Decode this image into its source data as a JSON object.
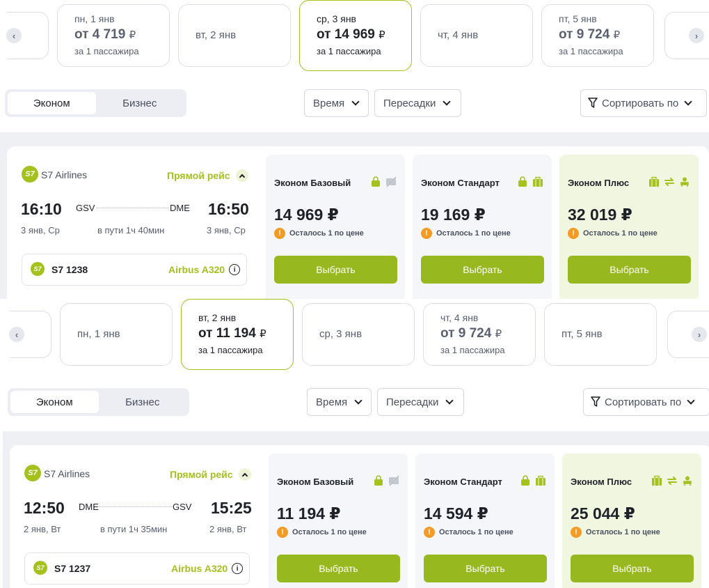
{
  "panels": [
    {
      "dates": [
        {
          "day": "пн, 1 янв",
          "prefix": "от",
          "price": "4 719",
          "currency": "₽",
          "passenger": "за 1 пассажира"
        },
        {
          "day": "вт, 2 янв"
        },
        {
          "day": "ср, 3 янв",
          "prefix": "от",
          "price": "14 969",
          "currency": "₽",
          "passenger": "за 1 пассажира",
          "active": true
        },
        {
          "day": "чт, 4 янв"
        },
        {
          "day": "пт, 5 янв",
          "prefix": "от",
          "price": "9 724",
          "currency": "₽",
          "passenger": "за 1 пассажира"
        }
      ],
      "class_toggle": {
        "economy": "Эконом",
        "business": "Бизнес",
        "selected": "Эконом"
      },
      "filters": {
        "time": "Время",
        "stops": "Пересадки",
        "sort": "Сортировать по"
      },
      "flight": {
        "airline": "S7 Airlines",
        "airline_logo": "S7",
        "direct": "Прямой рейс",
        "dep_time": "16:10",
        "dep_code": "GSV",
        "arr_code": "DME",
        "arr_time": "16:50",
        "dep_date": "3 янв, Ср",
        "duration": "в пути 1ч 40мин",
        "arr_date": "3 янв, Ср",
        "flight_number": "S7 1238",
        "aircraft": "Airbus A320"
      },
      "fares": [
        {
          "name": "Эконом Базовый",
          "price": "14 969 ₽",
          "left": "Осталось 1 по цене",
          "button": "Выбрать"
        },
        {
          "name": "Эконом Стандарт",
          "price": "19 169 ₽",
          "left": "Осталось 1 по цене",
          "button": "Выбрать"
        },
        {
          "name": "Эконом Плюс",
          "price": "32 019 ₽",
          "left": "Осталось 1 по цене",
          "button": "Выбрать"
        }
      ]
    },
    {
      "dates": [
        {
          "day": "пн, 1 янв"
        },
        {
          "day": "вт, 2 янв",
          "prefix": "от",
          "price": "11 194",
          "currency": "₽",
          "passenger": "за 1 пассажира",
          "active": true
        },
        {
          "day": "ср, 3 янв"
        },
        {
          "day": "чт, 4 янв",
          "prefix": "от",
          "price": "9 724",
          "currency": "₽",
          "passenger": "за 1 пассажира"
        },
        {
          "day": "пт, 5 янв"
        }
      ],
      "class_toggle": {
        "economy": "Эконом",
        "business": "Бизнес",
        "selected": "Эконом"
      },
      "filters": {
        "time": "Время",
        "stops": "Пересадки",
        "sort": "Сортировать по"
      },
      "flight": {
        "airline": "S7 Airlines",
        "airline_logo": "S7",
        "direct": "Прямой рейс",
        "dep_time": "12:50",
        "dep_code": "DME",
        "arr_code": "GSV",
        "arr_time": "15:25",
        "dep_date": "2 янв, Вт",
        "duration": "в пути 1ч 35мин",
        "arr_date": "2 янв, Вт",
        "flight_number": "S7 1237",
        "aircraft": "Airbus A320"
      },
      "fares": [
        {
          "name": "Эконом Базовый",
          "price": "11 194 ₽",
          "left": "Осталось 1 по цене",
          "button": "Выбрать"
        },
        {
          "name": "Эконом Стандарт",
          "price": "14 594 ₽",
          "left": "Осталось 1 по цене",
          "button": "Выбрать"
        },
        {
          "name": "Эконом Плюс",
          "price": "25 044 ₽",
          "left": "Осталось 1 по цене",
          "button": "Выбрать"
        }
      ]
    }
  ],
  "colors": {
    "accent": "#97b81f",
    "accent_text": "#a4c11e",
    "warning": "#f59a23",
    "band": "#eef0f4",
    "plus_bg": "#f0f6e0"
  },
  "icons": {
    "prev": "chevron-left-icon",
    "next": "chevron-right-icon",
    "filter": "funnel-icon",
    "info": "info-icon",
    "warning": "warning-icon",
    "bag": "bag-icon",
    "no_change": "no-change-icon",
    "suitcase": "suitcase-icon",
    "exchange": "exchange-icon",
    "seat": "seat-icon"
  }
}
